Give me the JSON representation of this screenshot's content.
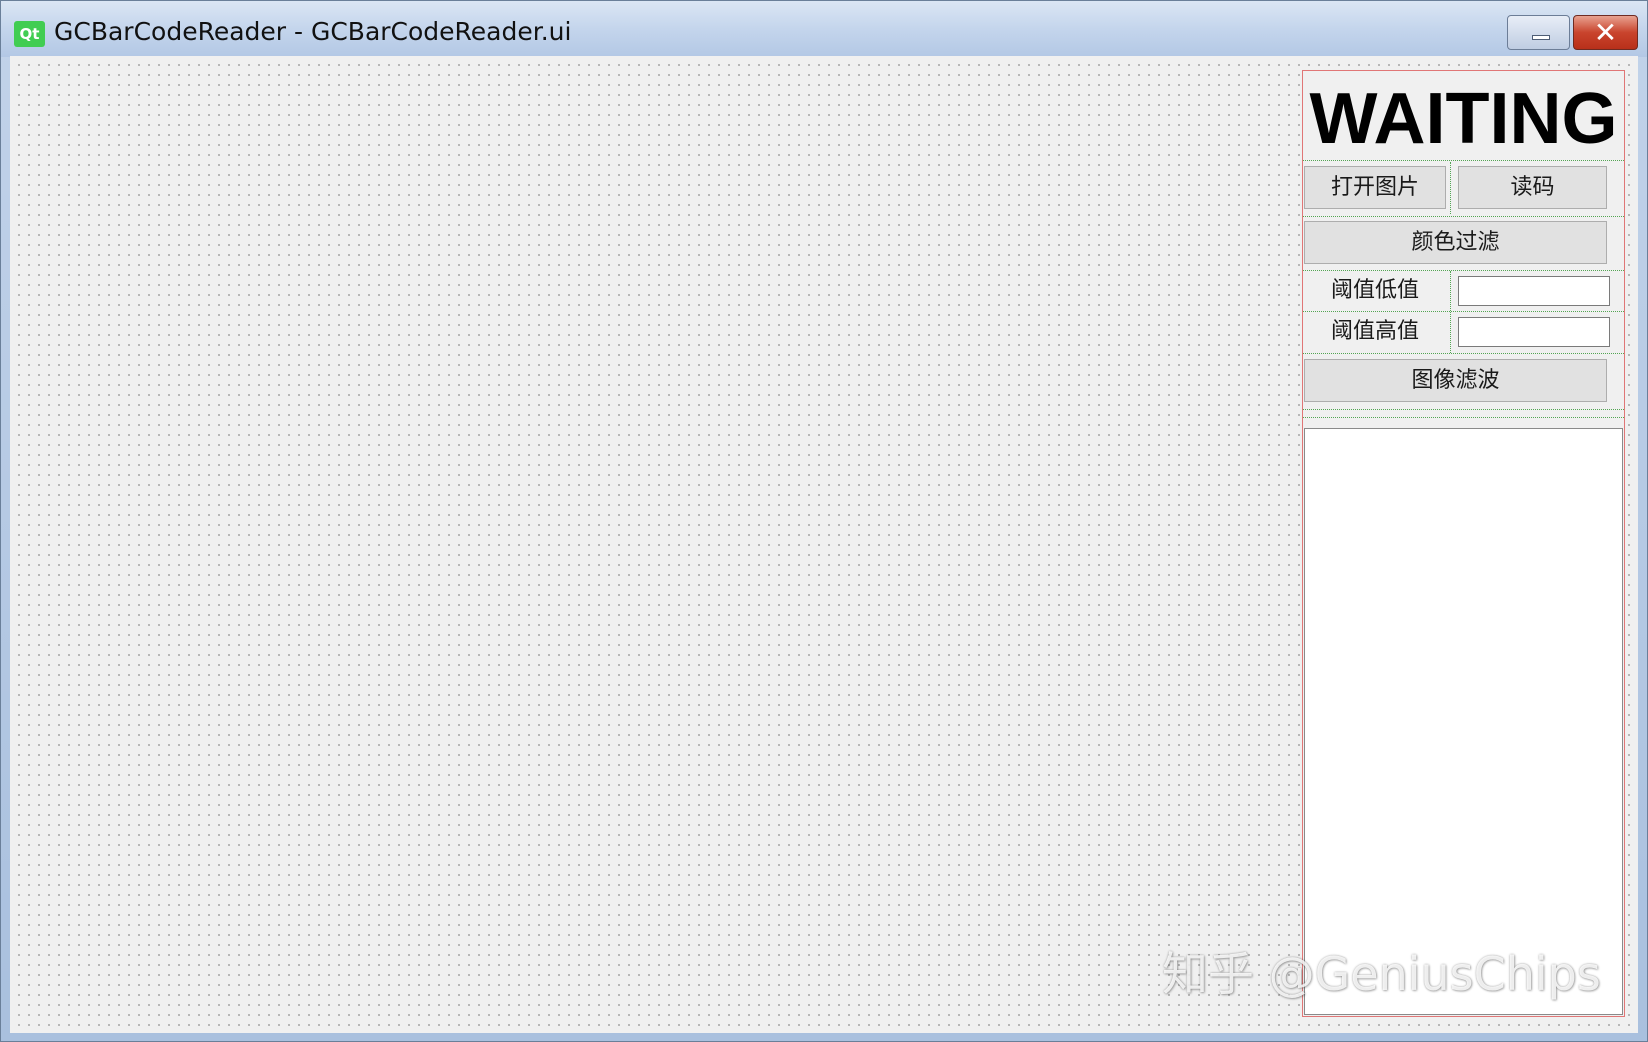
{
  "window": {
    "title": "GCBarCodeReader - GCBarCodeReader.ui",
    "app_icon_text": "Qt",
    "close_glyph": "✕"
  },
  "panel": {
    "status_text": "WAITING",
    "open_image_button": "打开图片",
    "read_code_button": "读码",
    "color_filter_button": "颜色过滤",
    "threshold_low_label": "阈值低值",
    "threshold_low_value": "",
    "threshold_high_label": "阈值高值",
    "threshold_high_value": "",
    "image_filter_button": "图像滤波"
  },
  "watermark": "知乎 @GeniusChips"
}
